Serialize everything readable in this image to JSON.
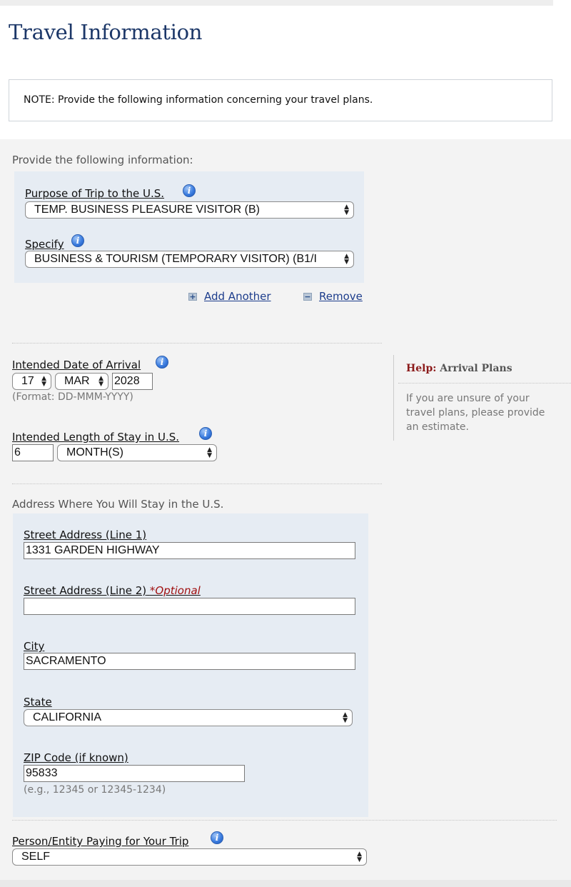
{
  "page": {
    "title": "Travel Information"
  },
  "note": {
    "text": "NOTE: Provide the following information concerning your travel plans."
  },
  "instructions": "Provide the following information:",
  "purpose": {
    "label": "Purpose of Trip to the U.S.",
    "value": "TEMP. BUSINESS PLEASURE VISITOR (B)"
  },
  "specify": {
    "label": "Specify",
    "value": "BUSINESS & TOURISM (TEMPORARY VISITOR) (B1/I"
  },
  "actions": {
    "add_label": "Add Another",
    "remove_label": "Remove"
  },
  "arrival": {
    "label": "Intended Date of Arrival",
    "day": "17",
    "month": "MAR",
    "year": "2028",
    "format_hint": "(Format: DD-MMM-YYYY)"
  },
  "stay": {
    "label": "Intended Length of Stay in U.S.",
    "number": "6",
    "unit": "MONTH(S)"
  },
  "help": {
    "prefix": "Help:",
    "title": "Arrival Plans",
    "body": "If you are unsure of your travel plans, please provide an estimate."
  },
  "address": {
    "section_label": "Address Where You Will Stay in the U.S.",
    "line1_label": "Street Address (Line 1)",
    "line1_value": "1331 GARDEN HIGHWAY",
    "line2_label": "Street Address (Line 2)",
    "optional_tag": "*Optional",
    "line2_value": "",
    "city_label": "City",
    "city_value": "SACRAMENTO",
    "state_label": "State",
    "state_value": "CALIFORNIA",
    "zip_label": "ZIP Code (if known)",
    "zip_value": "95833",
    "zip_hint": "(e.g., 12345 or 12345-1234)"
  },
  "payer": {
    "label": "Person/Entity Paying for Your Trip",
    "value": "SELF"
  },
  "colors": {
    "title": "#1c3768",
    "link": "#1d3d8c",
    "panel": "#e6ecf3",
    "help_accent": "#8b1a1a",
    "optional": "#a01010"
  },
  "icons": {
    "info": "info-icon",
    "add": "plus-icon",
    "remove": "minus-icon",
    "dropdown": "chevron-updown-icon"
  }
}
